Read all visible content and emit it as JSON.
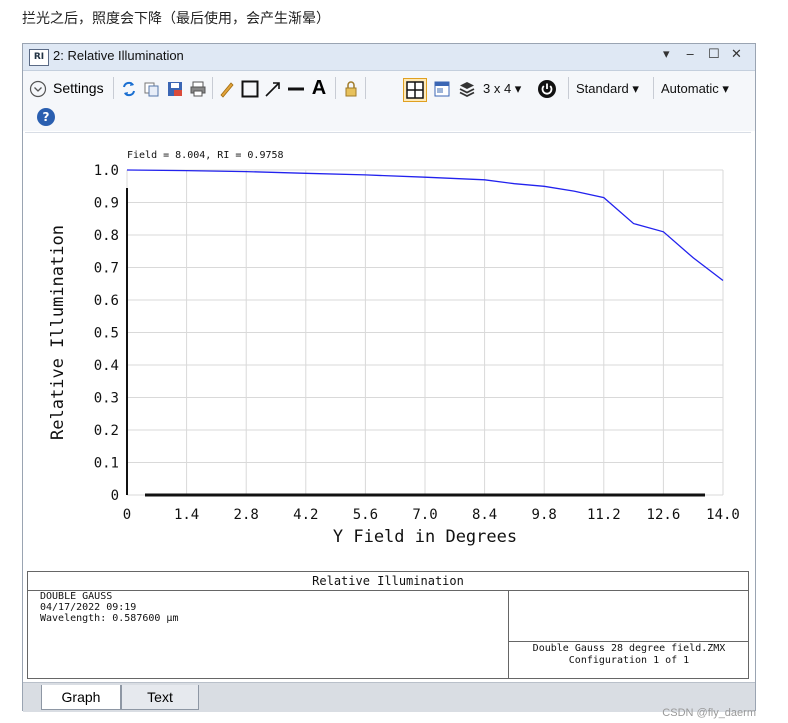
{
  "caption": "拦光之后，照度会下降（最后使用，会产生渐晕）",
  "window": {
    "icon_text": "RI",
    "title": "2: Relative Illumination",
    "controls": {
      "dropdown": "▾",
      "minimize": "‒",
      "maximize": "☐",
      "close": "✕"
    }
  },
  "toolbar": {
    "settings_label": "Settings",
    "layout_label": "3 x 4 ▾",
    "standard_label": "Standard ▾",
    "automatic_label": "Automatic ▾",
    "text_tool_label": "A",
    "help_label": "?"
  },
  "chart_data": {
    "type": "line",
    "annotation": "Field = 8.004, RI = 0.9758",
    "xlabel": "Y Field in Degrees",
    "ylabel": "Relative Illumination",
    "xlim": [
      0,
      14.0
    ],
    "ylim": [
      0,
      1.0
    ],
    "xticks": [
      "0",
      "1.4",
      "2.8",
      "4.2",
      "5.6",
      "7.0",
      "8.4",
      "9.8",
      "11.2",
      "12.6",
      "14.0"
    ],
    "yticks": [
      "0",
      "0.1",
      "0.2",
      "0.3",
      "0.4",
      "0.5",
      "0.6",
      "0.7",
      "0.8",
      "0.9",
      "1.0"
    ],
    "grid": true,
    "line_color": "#2222ee",
    "x": [
      0,
      1.4,
      2.8,
      4.2,
      5.6,
      7.0,
      8.4,
      9.1,
      9.8,
      10.5,
      11.2,
      11.9,
      12.6,
      13.3,
      14.0
    ],
    "y": [
      1.0,
      0.998,
      0.995,
      0.99,
      0.985,
      0.978,
      0.97,
      0.958,
      0.95,
      0.935,
      0.915,
      0.835,
      0.81,
      0.73,
      0.66
    ]
  },
  "info": {
    "title": "Relative Illumination",
    "left_lines": "DOUBLE GAUSS\n04/17/2022 09:19\nWavelength: 0.587600 µm",
    "right_line1": "Double Gauss 28 degree field.ZMX",
    "right_line2": "Configuration 1 of 1"
  },
  "tabs": [
    {
      "label": "Graph"
    },
    {
      "label": "Text"
    }
  ],
  "watermark": "CSDN @fly_daerm"
}
